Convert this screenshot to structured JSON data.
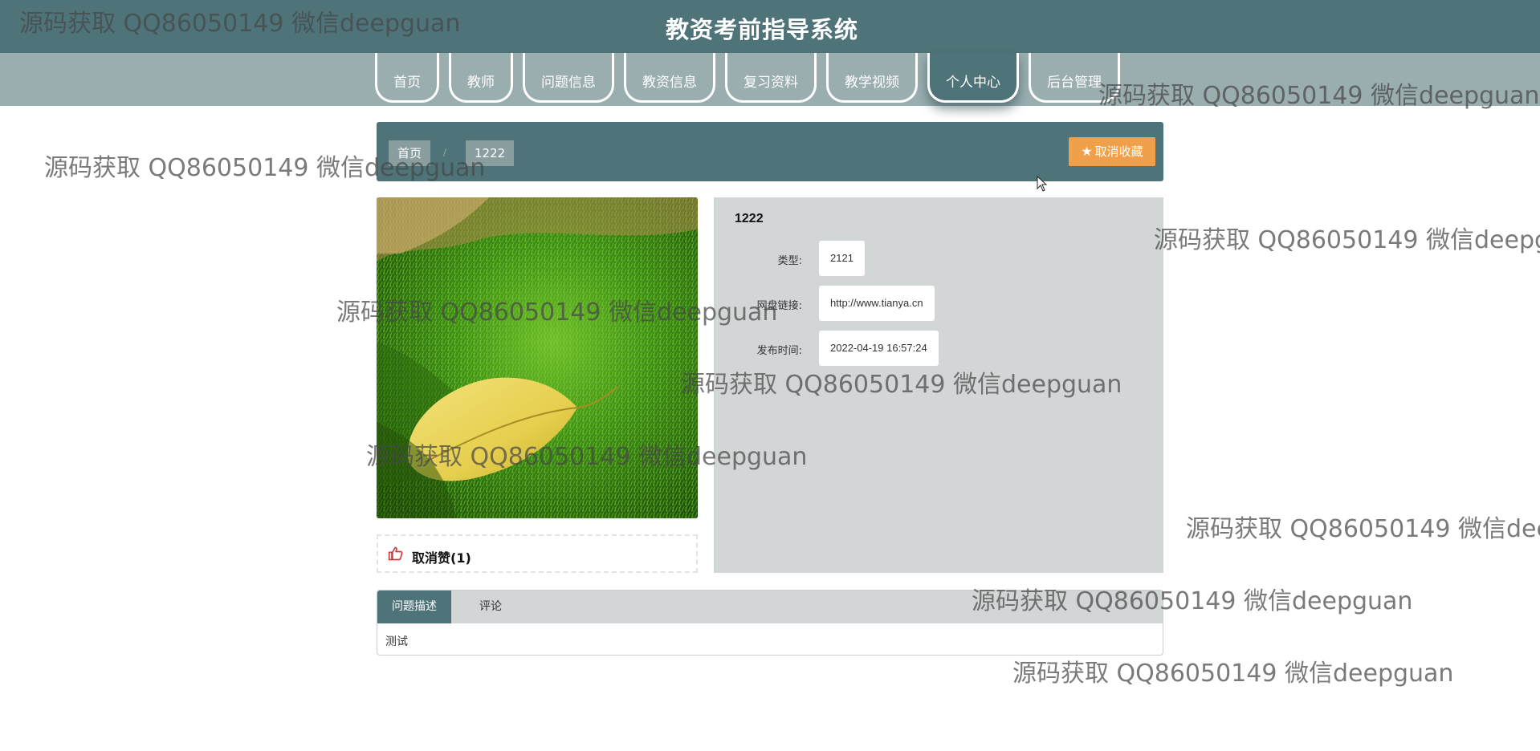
{
  "header": {
    "title": "教资考前指导系统"
  },
  "nav": {
    "items": [
      {
        "label": "首页",
        "active": false
      },
      {
        "label": "教师",
        "active": false
      },
      {
        "label": "问题信息",
        "active": false
      },
      {
        "label": "教资信息",
        "active": false
      },
      {
        "label": "复习资料",
        "active": false
      },
      {
        "label": "教学视频",
        "active": false
      },
      {
        "label": "个人中心",
        "active": true
      },
      {
        "label": "后台管理",
        "active": false
      }
    ]
  },
  "breadcrumb": {
    "home": "首页",
    "separator": "/",
    "current": "1222"
  },
  "favorite": {
    "label": "取消收藏",
    "icon": "star-icon"
  },
  "detail": {
    "title": "1222",
    "rows": [
      {
        "label": "类型:",
        "value": "2121"
      },
      {
        "label": "网盘链接:",
        "value": "http://www.tianya.cn"
      },
      {
        "label": "发布时间:",
        "value": "2022-04-19 16:57:24"
      }
    ]
  },
  "like": {
    "label": "取消赞(1)",
    "icon": "thumbs-up-icon"
  },
  "tabs": {
    "items": [
      {
        "label": "问题描述",
        "active": true
      },
      {
        "label": "评论",
        "active": false
      }
    ],
    "content": "测试"
  },
  "watermark": {
    "text": "源码获取 QQ86050149 微信deepguan"
  },
  "colors": {
    "primary": "#4e7479",
    "nav_bg": "#9aaeb0",
    "accent": "#f0a04b",
    "panel": "#d2d6d6"
  }
}
